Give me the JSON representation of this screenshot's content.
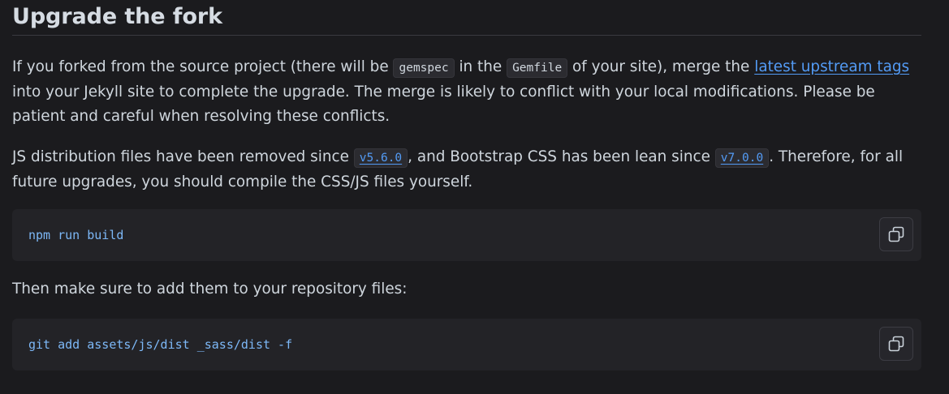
{
  "heading": "Upgrade the fork",
  "para1": {
    "t1": "If you forked from the source project (there will be ",
    "code1": "gemspec",
    "t2": " in the ",
    "code2": "Gemfile",
    "t3": " of your site), merge the ",
    "link": "latest upstream tags",
    "t4": " into your Jekyll site to complete the upgrade. The merge is likely to conflict with your local modifications. Please be patient and careful when resolving these conflicts."
  },
  "para2": {
    "t1": "JS distribution files have been removed since ",
    "code1": "v5.6.0",
    "t2": ", and Bootstrap CSS has been lean since ",
    "code2": "v7.0.0",
    "t3": ". Therefore, for all future upgrades, you should compile the CSS/JS files yourself."
  },
  "code_block_1": "npm run build",
  "para3": "Then make sure to add them to your repository files:",
  "code_block_2": "git add assets/js/dist _sass/dist -f",
  "icons": {
    "copy": "copy-icon"
  },
  "colors": {
    "background": "#1b1b1e",
    "link": "#539bf5",
    "code_text": "#7db8f7"
  }
}
